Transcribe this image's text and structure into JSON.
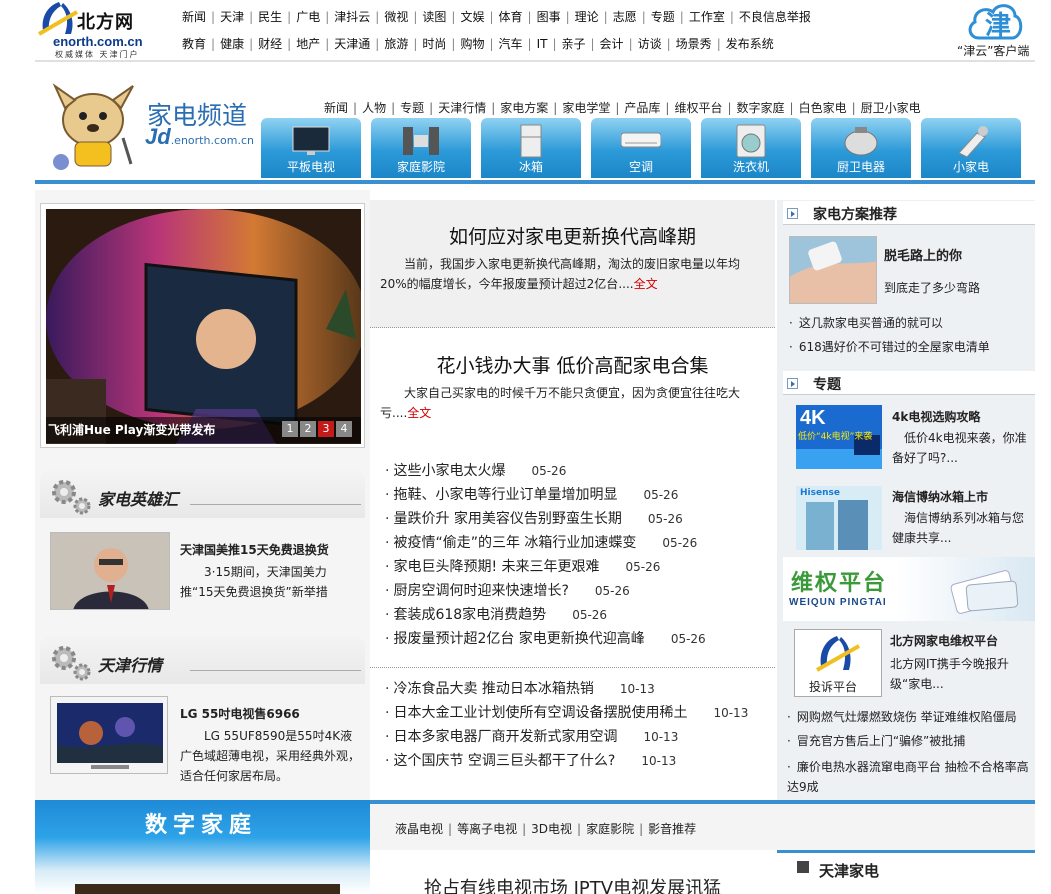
{
  "site": {
    "logo_cn": "北方网",
    "logo_en": "enorth.com.cn",
    "logo_slogan": "权威媒体 天津门户",
    "nav_row1": [
      "新闻",
      "天津",
      "民生",
      "广电",
      "津抖云",
      "微视",
      "读图",
      "文娱",
      "体育",
      "图事",
      "理论",
      "志愿",
      "专题",
      "工作室",
      "不良信息举报"
    ],
    "nav_row2": [
      "教育",
      "健康",
      "财经",
      "地产",
      "天津通",
      "旅游",
      "时尚",
      "购物",
      "汽车",
      "IT",
      "亲子",
      "会计",
      "访谈",
      "场景秀",
      "发布系统"
    ],
    "cloud_glyph": "津",
    "cloud_label": "“津云”客户端"
  },
  "channel": {
    "title": "家电频道",
    "sub_big": "Jd",
    "sub_small": ".enorth.com.cn",
    "nav": [
      "新闻",
      "人物",
      "专题",
      "天津行情",
      "家电方案",
      "家电学堂",
      "产品库",
      "维权平台",
      "数字家庭",
      "白色家电",
      "厨卫小家电"
    ],
    "categories": [
      {
        "label": "平板电视",
        "icon": "tv-icon"
      },
      {
        "label": "家庭影院",
        "icon": "home-theater-icon"
      },
      {
        "label": "冰箱",
        "icon": "fridge-icon"
      },
      {
        "label": "空调",
        "icon": "air-conditioner-icon"
      },
      {
        "label": "洗衣机",
        "icon": "washer-icon"
      },
      {
        "label": "厨卫电器",
        "icon": "cooker-icon"
      },
      {
        "label": "小家电",
        "icon": "mixer-icon"
      }
    ]
  },
  "slider": {
    "caption": "飞利浦Hue Play渐变光带发布",
    "pages": [
      "1",
      "2",
      "3",
      "4"
    ],
    "active_page": 3
  },
  "heroes": {
    "title": "家电英雄汇",
    "item_title": "天津国美推15天免费退换货",
    "item_desc": "3·15期间，天津国美力推“15天免费退换货”新举措"
  },
  "market": {
    "title": "天津行情",
    "item_title": "LG 55吋电视售6966",
    "item_desc": "LG 55UF8590是55吋4K液广色域超薄电视，采用经典外观，适合任何家居布局。"
  },
  "middle": {
    "story1": {
      "headline": "如何应对家电更新换代高峰期",
      "lede": "当前，我国步入家电更新换代高峰期，淘汰的废旧家电量以年均20%的幅度增长，今年报废量预计超过2亿台",
      "ellipsis": "....",
      "more": "全文"
    },
    "story2": {
      "headline": "花小钱办大事  低价高配家电合集",
      "lede": "大家自己买家电的时候千万不能只贪便宜，因为贪便宜往往吃大亏",
      "ellipsis": "....",
      "more": "全文"
    },
    "list1": [
      {
        "title": "这些小家电太火爆",
        "date": "05-26"
      },
      {
        "title": "拖鞋、小家电等行业订单量增加明显",
        "date": "05-26"
      },
      {
        "title": "量跌价升 家用美容仪告别野蛮生长期",
        "date": "05-26"
      },
      {
        "title": "被疫情“偷走”的三年 冰箱行业加速蝶变",
        "date": "05-26"
      },
      {
        "title": "家电巨头降预期! 未来三年更艰难",
        "date": "05-26"
      },
      {
        "title": "厨房空调何时迎来快速增长?",
        "date": "05-26"
      },
      {
        "title": "套装成618家电消费趋势",
        "date": "05-26"
      },
      {
        "title": "报废量预计超2亿台 家电更新换代迎高峰",
        "date": "05-26"
      }
    ],
    "list2": [
      {
        "title": "冷冻食品大卖 推动日本冰箱热销",
        "date": "10-13"
      },
      {
        "title": "日本大金工业计划使所有空调设备摆脱使用稀土",
        "date": "10-13"
      },
      {
        "title": "日本多家电器厂商开发新式家用空调",
        "date": "10-13"
      },
      {
        "title": "这个国庆节 空调三巨头都干了什么?",
        "date": "10-13"
      }
    ],
    "bottom_headline": "抢占有线电视市场 IPTV电视发展讯猛"
  },
  "right": {
    "plan_title": "家电方案推荐",
    "plan_item_title": "脱毛路上的你",
    "plan_item_sub": "到底走了多少弯路",
    "plan_bullets": [
      "这几款家电买普通的就可以",
      "618遇好价不可错过的全屋家电清单"
    ],
    "topic_title": "专题",
    "topic1_badge": "4K",
    "topic1_badge_sub": "低价“4k电视”来袭",
    "topic1_title": "4k电视选购攻略",
    "topic1_desc": "低价4k电视来袭，你准备好了吗?",
    "topic1_ellipsis": "...",
    "topic2_brand": "Hisense",
    "topic2_title": "海信博纳冰箱上市",
    "topic2_desc": "海信博纳系列冰箱与您健康共享",
    "topic2_ellipsis": "...",
    "rights_banner": "维权平台",
    "rights_banner_en": "WEIQUN PINGTAI",
    "rights_logo_text": "投诉平台",
    "rights_title": "北方网家电维权平台",
    "rights_desc": "北方网IT携手今晚报升级“家电",
    "rights_ellipsis": "...",
    "rights_bullets": [
      "网购燃气灶爆燃致烧伤 举证难维权陷僵局",
      "冒充官方售后上门“骗修”被批捕",
      "廉价电热水器流窜电商平台 抽检不合格率高达9成"
    ]
  },
  "bottom": {
    "digital_home_title": "数字家庭",
    "digital_links": [
      "液晶电视",
      "等离子电视",
      "3D电视",
      "家庭影院",
      "影音推荐"
    ],
    "tianjin_title": "天津家电"
  },
  "colors": {
    "accent_blue": "#3a8fd0",
    "link_red": "#d00000",
    "pager_active": "#c41a1a"
  }
}
